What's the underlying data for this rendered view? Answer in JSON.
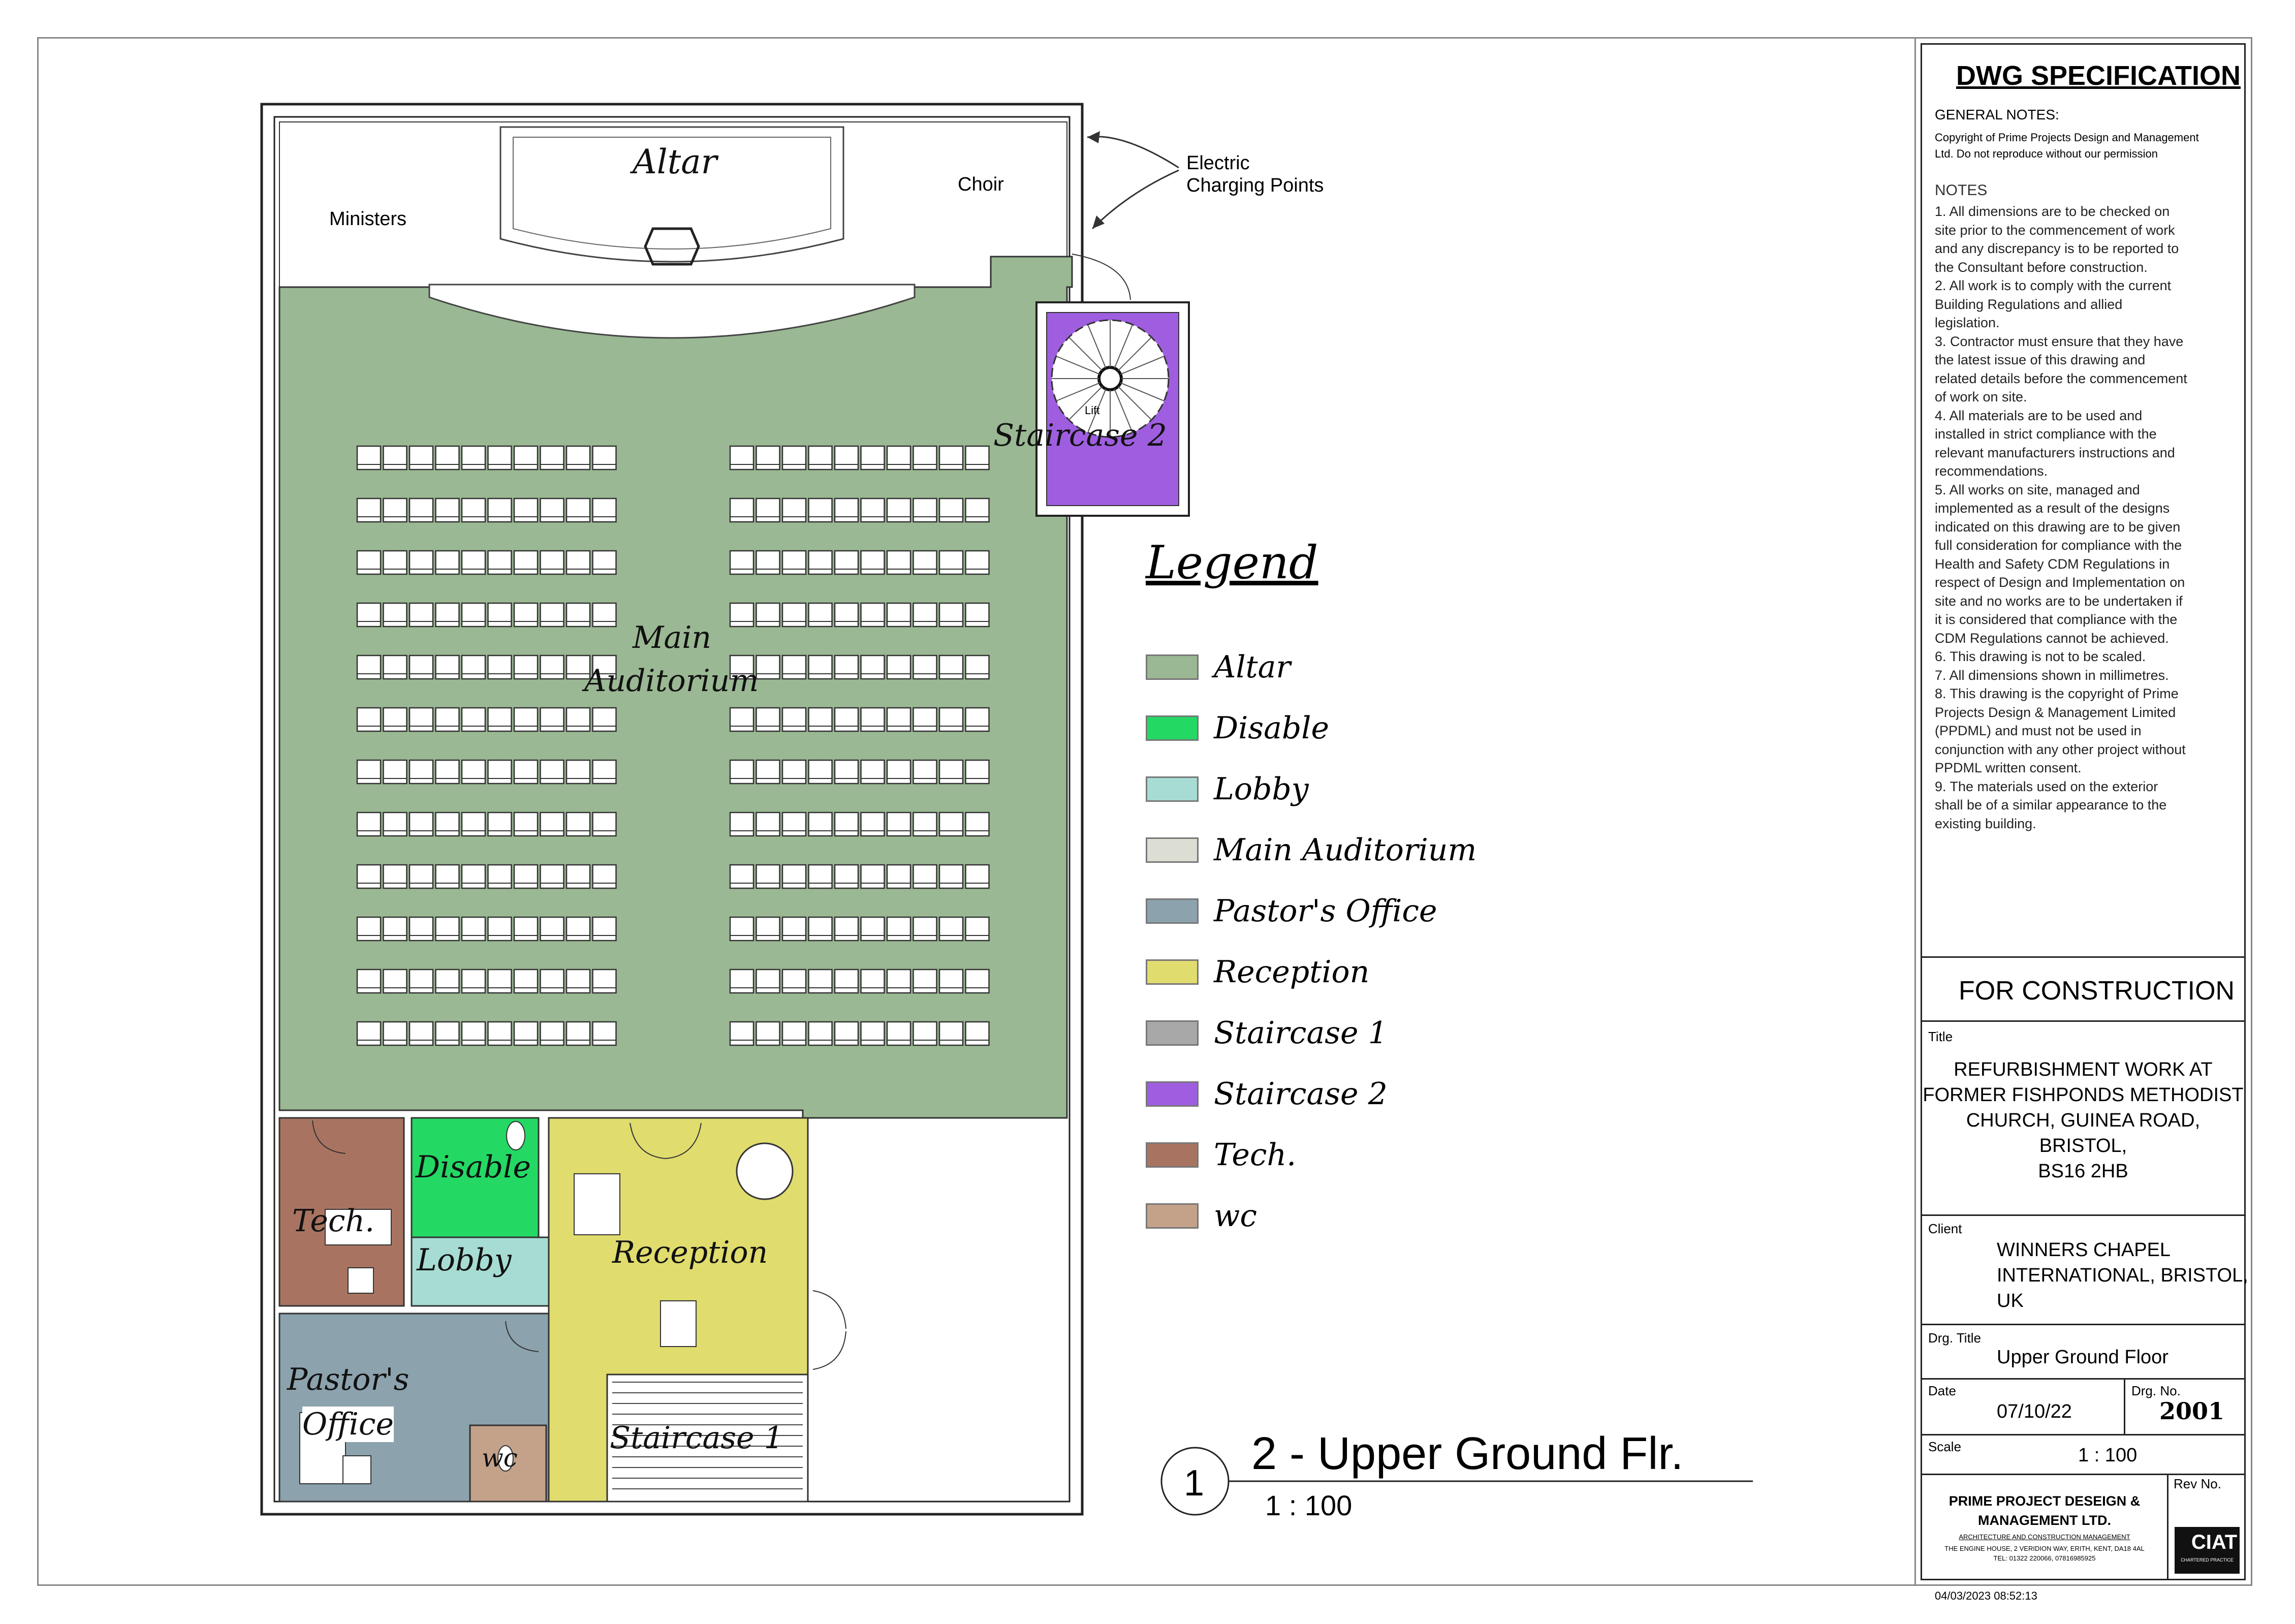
{
  "plan": {
    "labels": {
      "altar": "Altar",
      "choir": "Choir",
      "ministers": "Ministers",
      "electric": [
        "Electric",
        "Charging Points"
      ],
      "staircase2": "Staircase 2",
      "lift": "Lift",
      "main_auditorium": [
        "Main",
        "Auditorium"
      ],
      "disable": "Disable",
      "tech": "Tech.",
      "lobby": "Lobby",
      "reception": "Reception",
      "pastors_office": [
        "Pastor's",
        "Office"
      ],
      "wc": "wc",
      "staircase1": "Staircase 1"
    },
    "seating": {
      "rows": 12,
      "seats_per_block": 10,
      "blocks": 2
    }
  },
  "view": {
    "number": "1",
    "title": "2 - Upper Ground Flr.",
    "scale": "1 : 100"
  },
  "legend": {
    "title": "Legend",
    "items": [
      {
        "label": "Altar",
        "color": "#9ab893"
      },
      {
        "label": "Disable",
        "color": "#23d964"
      },
      {
        "label": "Lobby",
        "color": "#a6dcd3"
      },
      {
        "label": "Main Auditorium",
        "color": "#dcddd3"
      },
      {
        "label": "Pastor's Office",
        "color": "#8ca2ad"
      },
      {
        "label": "Reception",
        "color": "#e0dc6e"
      },
      {
        "label": "Staircase 1",
        "color": "#a8a8a8"
      },
      {
        "label": "Staircase 2",
        "color": "#9f5ee0"
      },
      {
        "label": "Tech.",
        "color": "#a87461"
      },
      {
        "label": "wc",
        "color": "#c4a28a"
      }
    ]
  },
  "title_block": {
    "heading": "DWG SPECIFICATION",
    "general_notes_label": "GENERAL NOTES:",
    "copyright": [
      "Copyright of Prime Projects Design and Management",
      "Ltd. Do not reproduce without our permission"
    ],
    "notes_label": "NOTES",
    "notes_lines": [
      "1. All dimensions are to be checked on",
      "site prior to the commencement of work",
      "and any discrepancy is to be reported to",
      "the Consultant before construction.",
      "2. All work is to comply with the current",
      "Building Regulations and allied",
      "legislation.",
      "3. Contractor must ensure that they have",
      "the latest issue of this drawing and",
      "related details before the commencement",
      "of work on site.",
      "4. All materials are to be used and",
      "installed in strict compliance with the",
      "relevant manufacturers instructions and",
      "recommendations.",
      "5. All works on site, managed and",
      "implemented as a result of the designs",
      "indicated on this drawing are to be given",
      "full consideration for compliance with the",
      "Health and Safety CDM Regulations in",
      "respect of Design and Implementation on",
      "site and no works are to be undertaken if",
      "it is considered that compliance with the",
      "CDM Regulations cannot be achieved.",
      "6. This drawing is not to be scaled.",
      "7. All dimensions shown in millimetres.",
      "8. This drawing is the copyright of Prime",
      "Projects Design & Management Limited",
      "(PPDML) and must not be used in",
      "conjunction with any other project without",
      "PPDML written consent.",
      "9. The materials used on the exterior",
      "shall be of a similar appearance to the",
      "existing building."
    ],
    "status": "FOR CONSTRUCTION",
    "title_label": "Title",
    "title_lines": [
      "REFURBISHMENT WORK AT",
      "FORMER FISHPONDS METHODIST",
      "CHURCH, GUINEA ROAD, BRISTOL,",
      "BS16 2HB"
    ],
    "client_label": "Client",
    "client_lines": [
      "WINNERS CHAPEL",
      "INTERNATIONAL, BRISTOL,",
      "UK"
    ],
    "drg_title_label": "Drg. Title",
    "drg_title": "Upper Ground Floor",
    "date_label": "Date",
    "date": "07/10/22",
    "drg_no_label": "Drg. No.",
    "drg_no": "2001",
    "scale_label": "Scale",
    "scale": "1 : 100",
    "rev_label": "Rev No.",
    "company": [
      "PRIME PROJECT DESEIGN &",
      "MANAGEMENT LTD."
    ],
    "company_tagline": "ARCHITECTURE AND CONSTRUCTION MANAGEMENT",
    "address": "THE ENGINE HOUSE, 2 VERIDION WAY, ERITH, KENT, DA18 4AL",
    "phone": "TEL: 01322 220066, 07816985925",
    "ciat": "CIAT",
    "ciat_sub": "CHARTERED PRACTICE",
    "timestamp": "04/03/2023 08:52:13"
  }
}
